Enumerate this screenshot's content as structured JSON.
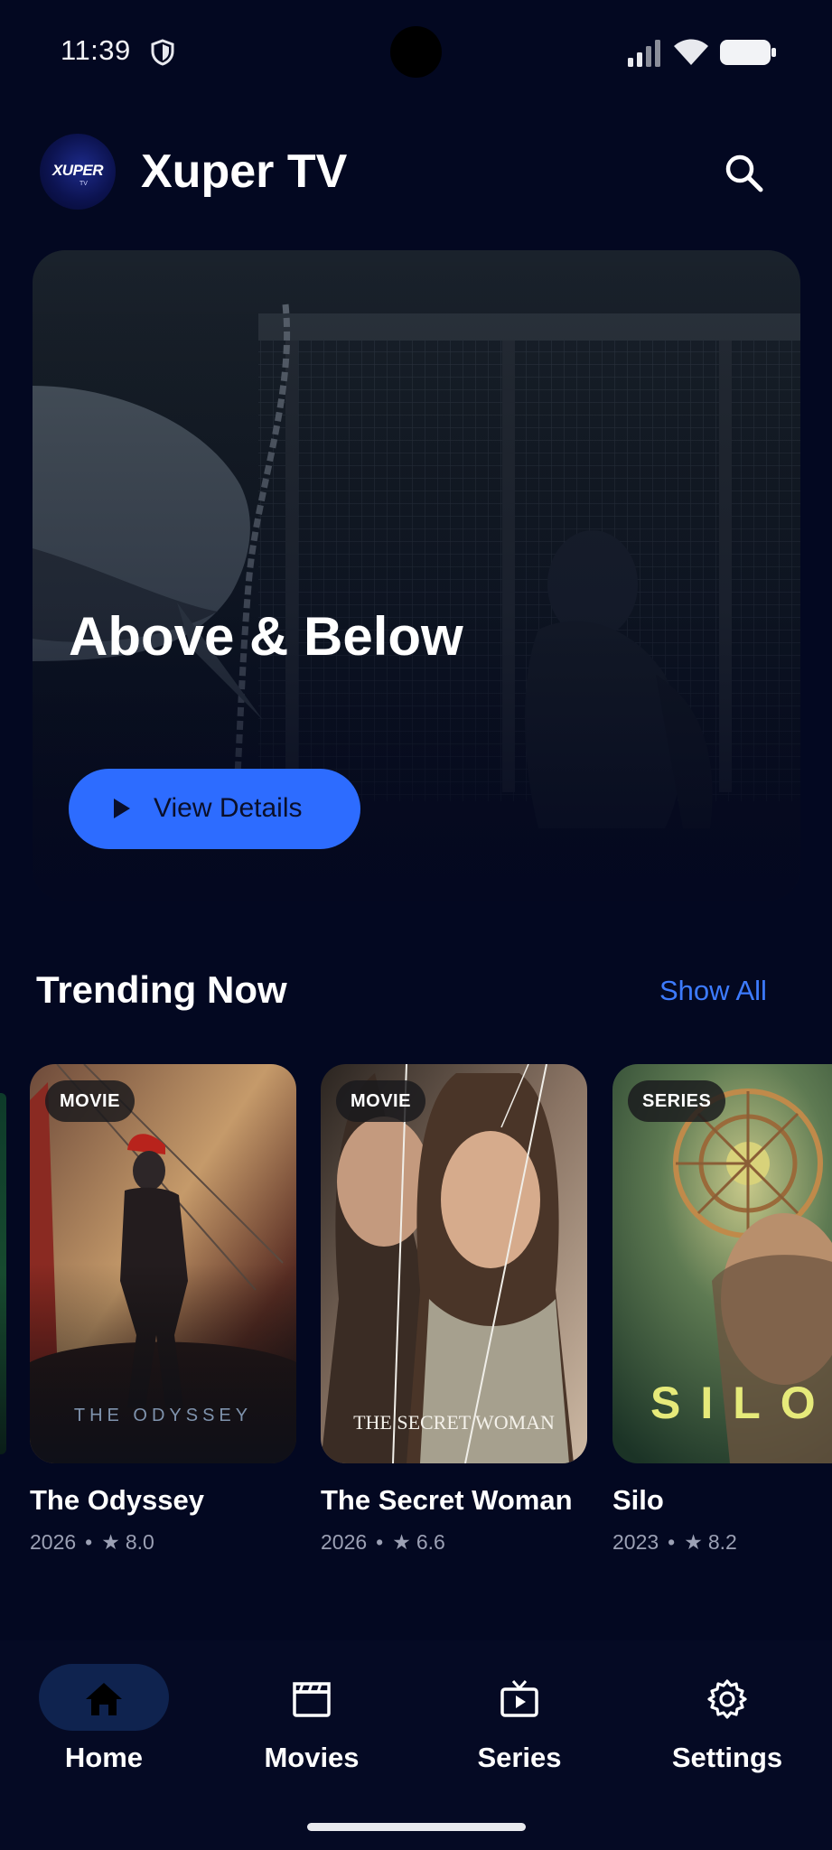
{
  "status_bar": {
    "time": "11:39"
  },
  "header": {
    "app_name": "Xuper TV",
    "logo_text": "XUPER",
    "logo_sub": "TV"
  },
  "hero": {
    "title": "Above & Below",
    "button_label": "View Details"
  },
  "trending": {
    "title": "Trending Now",
    "show_all": "Show All",
    "items": [
      {
        "badge": "MOVIE",
        "poster_text": "THE ODYSSEY",
        "title": "The Odyssey",
        "year": "2026",
        "rating": "8.0"
      },
      {
        "badge": "MOVIE",
        "poster_text": "THE SECRET WOMAN",
        "title": "The Secret Woman",
        "year": "2026",
        "rating": "6.6"
      },
      {
        "badge": "SERIES",
        "poster_text": "SILO",
        "title": "Silo",
        "year": "2023",
        "rating": "8.2"
      }
    ],
    "separator": "•",
    "star": "★"
  },
  "bottom_nav": {
    "items": [
      {
        "label": "Home",
        "icon": "home-icon",
        "active": true
      },
      {
        "label": "Movies",
        "icon": "clapperboard-icon",
        "active": false
      },
      {
        "label": "Series",
        "icon": "tv-play-icon",
        "active": false
      },
      {
        "label": "Settings",
        "icon": "gear-icon",
        "active": false
      }
    ]
  },
  "colors": {
    "background": "#030821",
    "accent": "#2d6cff",
    "link": "#3d7bff",
    "nav_active_pill": "#0f234f"
  }
}
